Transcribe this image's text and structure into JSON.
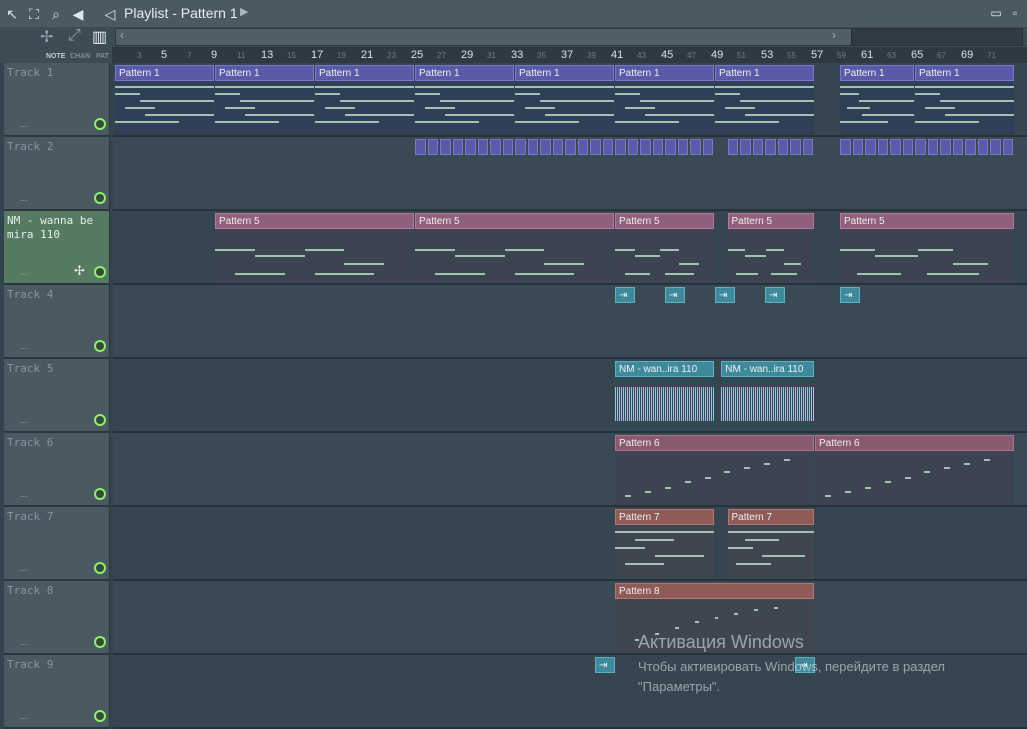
{
  "window": {
    "title": "Playlist - Pattern 1",
    "icons": [
      "pointer-icon",
      "select-icon",
      "zoom-icon",
      "speaker-icon",
      "play-arrow-icon"
    ],
    "minimize": "▭",
    "close": "▫"
  },
  "header_tabs": {
    "note": "NOTE",
    "chan": "CHAN",
    "pat": "PAT"
  },
  "ruler": {
    "bars": [
      "5",
      "9",
      "13",
      "17",
      "21",
      "25",
      "29",
      "33",
      "37",
      "41",
      "45",
      "49",
      "53",
      "57",
      "61",
      "65",
      "69"
    ],
    "minor": [
      "3",
      "7",
      "11",
      "15",
      "19",
      "23",
      "27",
      "31",
      "35",
      "39",
      "43",
      "47",
      "51",
      "55",
      "59",
      "63",
      "67",
      "71"
    ]
  },
  "tracks": [
    {
      "name": "Track 1",
      "active": false
    },
    {
      "name": "Track 2",
      "active": false
    },
    {
      "name": "NM - wanna be mira 110",
      "active": true
    },
    {
      "name": "Track 4",
      "active": false
    },
    {
      "name": "Track 5",
      "active": false
    },
    {
      "name": "Track 6",
      "active": false
    },
    {
      "name": "Track 7",
      "active": false
    },
    {
      "name": "Track 8",
      "active": false
    },
    {
      "name": "Track 9",
      "active": false
    }
  ],
  "track_dots": "...",
  "clips": {
    "pattern1": "Pattern 1",
    "pattern5": "Pattern 5",
    "pattern6": "Pattern 6",
    "pattern7": "Pattern 7",
    "pattern8": "Pattern 8",
    "audio": "NM - wan..ira 110"
  },
  "watermark": {
    "line1": "Активация Windows",
    "line2": "Чтобы активировать Windows, перейдите в раздел",
    "line3": "\"Параметры\"."
  }
}
